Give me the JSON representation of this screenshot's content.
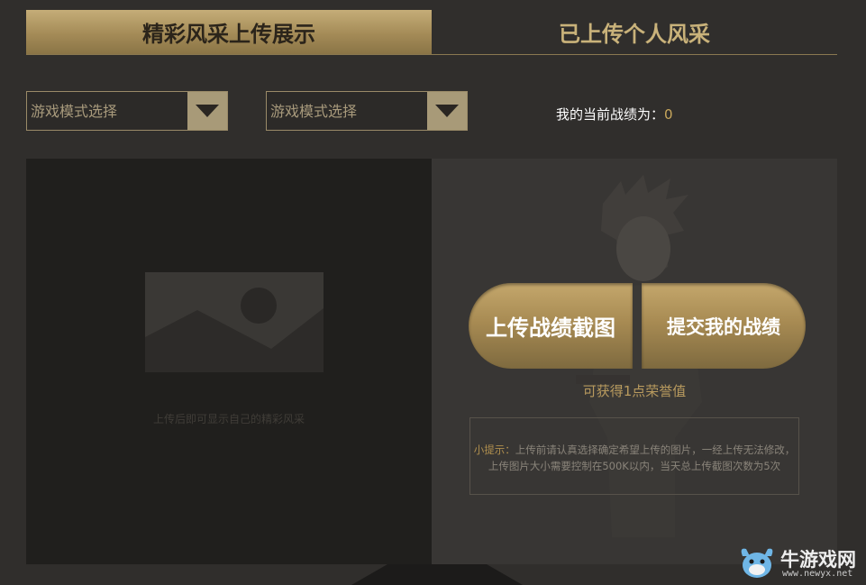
{
  "tabs": [
    {
      "label": "精彩风采上传展示",
      "active": true
    },
    {
      "label": "已上传个人风采",
      "active": false
    }
  ],
  "filters": {
    "mode_select_1": "游戏模式选择",
    "mode_select_2": "游戏模式选择"
  },
  "score": {
    "label": "我的当前战绩为：",
    "value": "0"
  },
  "preview": {
    "hint": "上传后即可显示自己的精彩风采"
  },
  "actions": {
    "upload_label": "上传战绩截图",
    "submit_label": "提交我的战绩",
    "reward_text": "可获得1点荣誉值"
  },
  "tip": {
    "label": "小提示：",
    "text": "上传前请认真选择确定希望上传的图片，一经上传无法修改，上传图片大小需要控制在500K以内，当天总上传截图次数为5次"
  },
  "watermark": {
    "name": "牛游戏网",
    "url": "www.newyx.net"
  },
  "colors": {
    "background": "#302e2c",
    "accent_gold": "#b89a5e",
    "tab_active": "#a48b57"
  },
  "icons": [
    "dropdown-arrow-icon",
    "image-placeholder-icon",
    "newyx-logo-icon"
  ]
}
